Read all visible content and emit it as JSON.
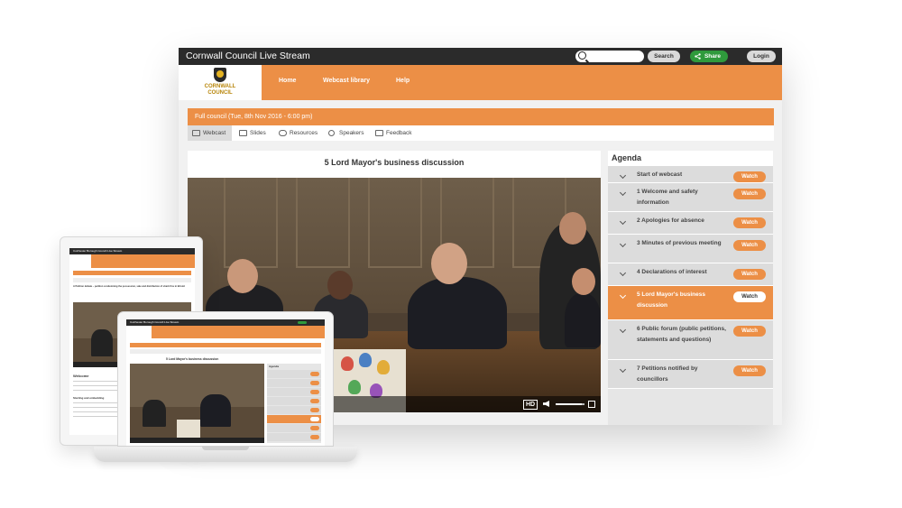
{
  "desktop": {
    "app_title": "Cornwall Council Live Stream",
    "search": {
      "placeholder": "",
      "button_label": "Search"
    },
    "share_label": "Share",
    "login_label": "Login",
    "logo_text_line1": "CORNWALL",
    "logo_text_line2": "COUNCIL",
    "nav": [
      "Home",
      "Webcast library",
      "Help"
    ],
    "meeting_title": "Full council (Tue, 8th Nov 2016 - 6:00 pm)",
    "tabs": [
      "Webcast",
      "Slides",
      "Resources",
      "Speakers",
      "Feedback"
    ],
    "active_tab": "Webcast",
    "player_title": "5 Lord Mayor's business discussion",
    "player_controls": {
      "hd_label": "HD",
      "volume_level": 0.9
    },
    "agenda": {
      "title": "Agenda",
      "watch_label": "Watch",
      "items": [
        {
          "label": "Start of webcast",
          "active": false
        },
        {
          "label": "1 Welcome and safety information",
          "active": false
        },
        {
          "label": "2 Apologies for absence",
          "active": false
        },
        {
          "label": "3 Minutes of previous meeting",
          "active": false
        },
        {
          "label": "4 Declarations of interest",
          "active": false
        },
        {
          "label": "5 Lord Mayor's business discussion",
          "active": true
        },
        {
          "label": "6 Public forum (public petitions, statements and questions)",
          "active": false
        },
        {
          "label": "7 Petitions notified by councillors",
          "active": false
        }
      ]
    }
  },
  "colors": {
    "accent_orange": "#ec8f46",
    "topbar_dark": "#2b2b2b",
    "share_green": "#2f9a3c",
    "panel_grey": "#dcdcdc"
  },
  "tablet": {
    "app_title": "Colchester Borough Council Live Stream",
    "headline": "A Petition debate – petition condemning the possession, sale and distribution of shark fins in Bristol",
    "welcome_heading": "Welcome",
    "section_heading": "Starting and embedding"
  },
  "laptop": {
    "app_title": "Colchester Borough Council Live Stream",
    "player_title": "5 Lord Mayor's business discussion",
    "agenda_title": "Agenda"
  }
}
